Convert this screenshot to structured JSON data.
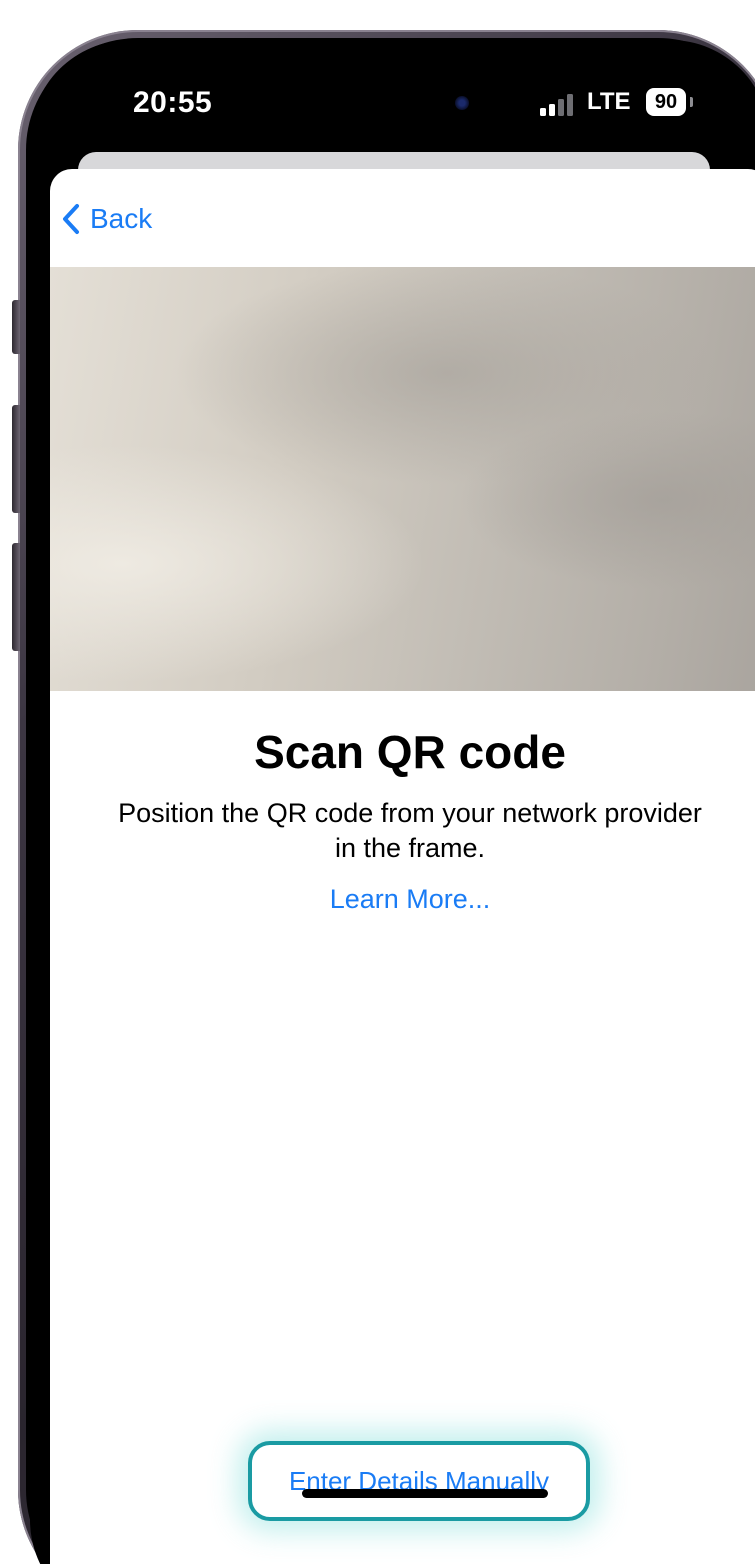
{
  "status_bar": {
    "time": "20:55",
    "network": "LTE",
    "battery": "90"
  },
  "nav": {
    "back_label": "Back"
  },
  "main": {
    "title": "Scan QR code",
    "subtitle": "Position the QR code from your network provider in the frame.",
    "learn_more_label": "Learn More...",
    "manual_button_label": "Enter Details Manually"
  },
  "colors": {
    "accent": "#1a7cf5",
    "highlight": "#1a9ba3"
  }
}
